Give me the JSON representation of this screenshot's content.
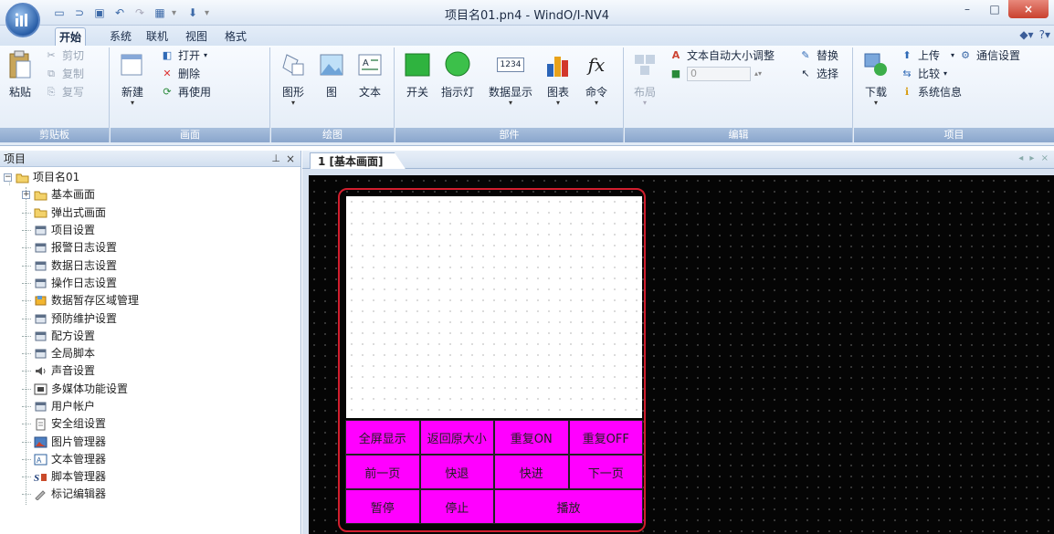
{
  "window": {
    "title": "项目名01.pn4 - WindO/I-NV4",
    "minimize": "–",
    "maximize": "□",
    "close": "×"
  },
  "ribbon_tabs": [
    "开始",
    "系统",
    "联机",
    "视图",
    "格式"
  ],
  "ribbon": {
    "clipboard": {
      "paste": "粘贴",
      "cut": "剪切",
      "copy": "复制",
      "copy_format": "复写",
      "label": "剪贴板"
    },
    "screen": {
      "new": "新建",
      "open": "打开",
      "delete": "删除",
      "reuse": "再使用",
      "label": "画面"
    },
    "drawing": {
      "shape": "图形",
      "image": "图",
      "text": "文本",
      "label": "绘图"
    },
    "parts": {
      "switch": "开关",
      "lamp": "指示灯",
      "data_display": "数据显示",
      "data_display_icon": "1234",
      "chart": "图表",
      "command": "命令",
      "command_icon": "fx",
      "label": "部件"
    },
    "edit": {
      "layout": "布局",
      "auto_text_size": "文本自动大小调整",
      "value": "0",
      "replace": "替换",
      "select": "选择",
      "label": "编辑"
    },
    "project": {
      "download": "下载",
      "upload": "上传",
      "comm_settings": "通信设置",
      "compare": "比较",
      "system_info": "系统信息",
      "label": "项目"
    }
  },
  "project_pane": {
    "title": "项目",
    "pin": "⊥",
    "close": "×",
    "tree": [
      {
        "label": "项目名01",
        "icon": "folder-icon"
      },
      {
        "label": "基本画面",
        "icon": "folder-icon"
      },
      {
        "label": "弹出式画面",
        "icon": "folder-icon"
      },
      {
        "label": "项目设置",
        "icon": "settings-icon"
      },
      {
        "label": "报警日志设置",
        "icon": "settings-icon"
      },
      {
        "label": "数据日志设置",
        "icon": "settings-icon"
      },
      {
        "label": "操作日志设置",
        "icon": "settings-icon"
      },
      {
        "label": "数据暂存区域管理",
        "icon": "data-storage-icon"
      },
      {
        "label": "预防维护设置",
        "icon": "settings-icon"
      },
      {
        "label": "配方设置",
        "icon": "settings-icon"
      },
      {
        "label": "全局脚本",
        "icon": "settings-icon"
      },
      {
        "label": "声音设置",
        "icon": "speaker-icon"
      },
      {
        "label": "多媒体功能设置",
        "icon": "multimedia-icon"
      },
      {
        "label": "用户帐户",
        "icon": "settings-icon"
      },
      {
        "label": "安全组设置",
        "icon": "document-icon"
      },
      {
        "label": "图片管理器",
        "icon": "picture-icon"
      },
      {
        "label": "文本管理器",
        "icon": "text-manager-icon"
      },
      {
        "label": "脚本管理器",
        "icon": "script-icon"
      },
      {
        "label": "标记编辑器",
        "icon": "pen-icon"
      }
    ]
  },
  "editor": {
    "tab": "1  [基本画面]",
    "tab_controls": "◂ ▸ ×",
    "buttons": [
      {
        "label": "全屏显示"
      },
      {
        "label": "返回原大小"
      },
      {
        "label": "重复ON"
      },
      {
        "label": "重复OFF"
      },
      {
        "label": "前一页"
      },
      {
        "label": "快退"
      },
      {
        "label": "快进"
      },
      {
        "label": "下一页"
      },
      {
        "label": "暂停"
      },
      {
        "label": "停止"
      },
      {
        "label": "播放"
      }
    ]
  },
  "colors": {
    "accent_magenta": "#ff00ff",
    "frame_red": "#d21e2e",
    "ribbon_blue": "#8aa6cc"
  }
}
